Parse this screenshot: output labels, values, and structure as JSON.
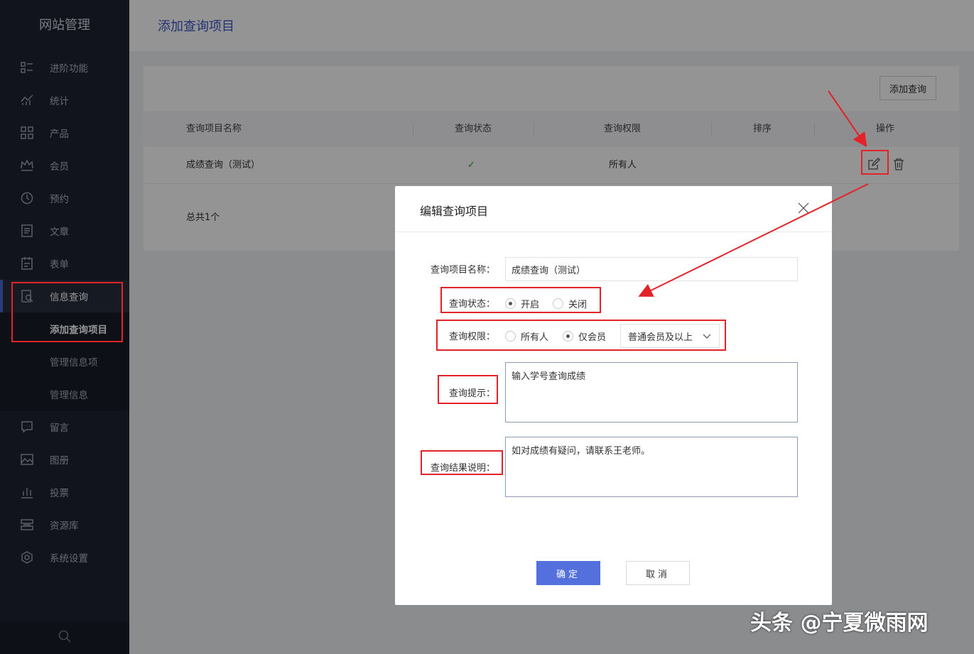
{
  "sidebar": {
    "brand": "网站管理",
    "items": [
      {
        "label": "进阶功能",
        "icon": "advanced-features-icon"
      },
      {
        "label": "统计",
        "icon": "statistics-icon"
      },
      {
        "label": "产品",
        "icon": "products-icon"
      },
      {
        "label": "会员",
        "icon": "members-crown-icon"
      },
      {
        "label": "预约",
        "icon": "booking-clock-icon"
      },
      {
        "label": "文章",
        "icon": "article-icon"
      },
      {
        "label": "表单",
        "icon": "form-icon"
      },
      {
        "label": "信息查询",
        "icon": "info-query-icon"
      }
    ],
    "sub_items": [
      "添加查询项目",
      "管理信息项",
      "管理信息"
    ],
    "items_after": [
      {
        "label": "留言",
        "icon": "message-icon"
      },
      {
        "label": "图册",
        "icon": "gallery-icon"
      },
      {
        "label": "投票",
        "icon": "vote-icon"
      },
      {
        "label": "资源库",
        "icon": "resource-icon"
      },
      {
        "label": "系统设置",
        "icon": "settings-icon"
      }
    ]
  },
  "header": {
    "title": "添加查询项目"
  },
  "toolbar": {
    "add_label": "添加查询"
  },
  "table": {
    "columns": [
      "查询项目名称",
      "查询状态",
      "查询权限",
      "排序",
      "操作"
    ],
    "rows": [
      {
        "name": "成绩查询（测试）",
        "status": "✓",
        "permission": "所有人",
        "order": ""
      }
    ],
    "total": "总共1个"
  },
  "modal": {
    "title": "编辑查询项目",
    "name_label": "查询项目名称：",
    "name_value": "成绩查询（测试）",
    "status_label": "查询状态：",
    "status_options": [
      "开启",
      "关闭"
    ],
    "status_selected": "开启",
    "permission_label": "查询权限：",
    "permission_options": [
      "所有人",
      "仅会员"
    ],
    "permission_selected": "仅会员",
    "member_level": "普通会员及以上",
    "hint_label": "查询提示：",
    "hint_value": "输入学号查询成绩",
    "result_label": "查询结果说明：",
    "result_value": "如对成绩有疑问，请联系王老师。",
    "ok_label": "确定",
    "cancel_label": "取消"
  },
  "watermark": "头条 @宁夏微雨网",
  "colors": {
    "accent": "#4a64d8",
    "annotation": "#e3232a",
    "sidebar": "#1f2433"
  }
}
